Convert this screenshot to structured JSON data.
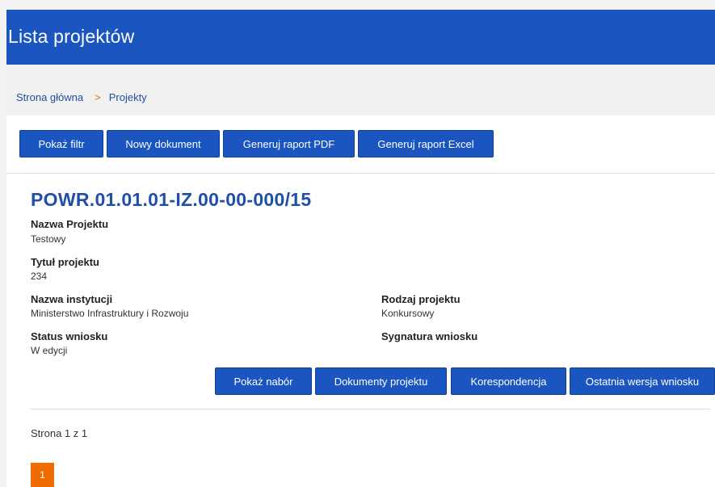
{
  "header": {
    "title": "Lista projektów"
  },
  "breadcrumb": {
    "home": "Strona główna",
    "separator": ">",
    "current": "Projekty"
  },
  "toolbar": {
    "show_filter": "Pokaż filtr",
    "new_document": "Nowy dokument",
    "report_pdf": "Generuj raport PDF",
    "report_excel": "Generuj raport Excel"
  },
  "project": {
    "id": "POWR.01.01.01-IZ.00-00-000/15",
    "name_label": "Nazwa Projektu",
    "name_value": "Testowy",
    "title_label": "Tytuł projektu",
    "title_value": "234",
    "institution_label": "Nazwa instytucji",
    "institution_value": "Ministerstwo Infrastruktury i Rozwoju",
    "type_label": "Rodzaj projektu",
    "type_value": "Konkursowy",
    "status_label": "Status wniosku",
    "status_value": "W edycji",
    "signature_label": "Sygnatura wniosku",
    "signature_value": ""
  },
  "project_actions": {
    "show_call": "Pokaż nabór",
    "documents": "Dokumenty projektu",
    "correspondence": "Korespondencja",
    "latest_version": "Ostatnia wersja wniosku"
  },
  "pagination": {
    "info": "Strona 1 z 1",
    "current_page": "1"
  },
  "colors": {
    "primary": "#1a55c0",
    "accent": "#ef6c00"
  }
}
